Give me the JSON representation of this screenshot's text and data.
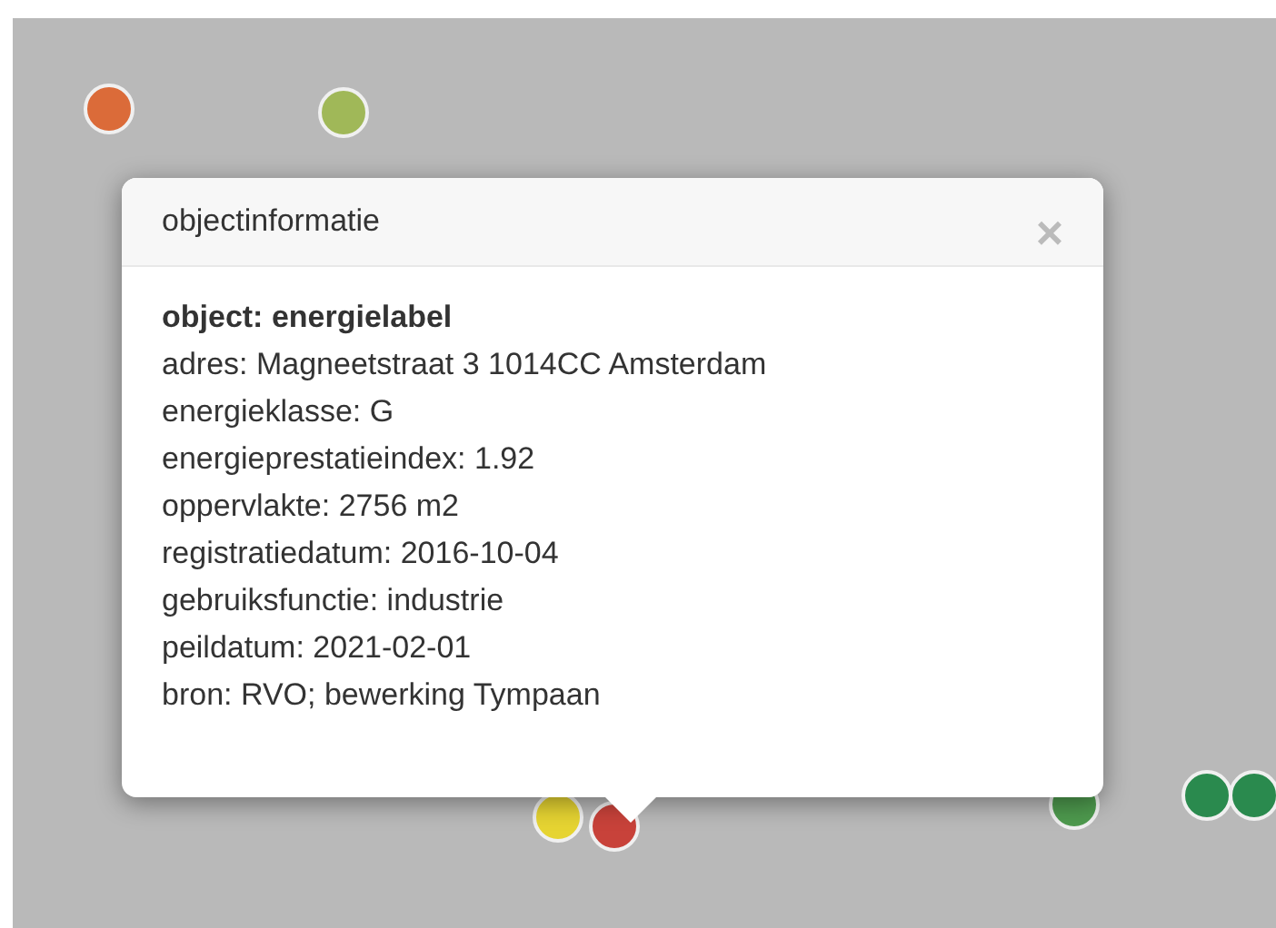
{
  "markers": [
    {
      "color": "#db6b39"
    },
    {
      "color": "#a0b858"
    },
    {
      "color": "#e6d432"
    },
    {
      "color": "#c8423a"
    },
    {
      "color": "#4e9a4e"
    },
    {
      "color": "#2a8a4e"
    },
    {
      "color": "#2a8a4e"
    }
  ],
  "popup": {
    "title": "objectinformatie",
    "close": "×",
    "lines": [
      {
        "kind": "heading",
        "text": "object: energielabel"
      },
      {
        "kind": "field",
        "text": "adres: Magneetstraat 3 1014CC Amsterdam"
      },
      {
        "kind": "field",
        "text": "energieklasse: G"
      },
      {
        "kind": "field",
        "text": "energieprestatieindex: 1.92"
      },
      {
        "kind": "field",
        "text": "oppervlakte: 2756 m2"
      },
      {
        "kind": "field",
        "text": "registratiedatum: 2016-10-04"
      },
      {
        "kind": "field",
        "text": "gebruiksfunctie: industrie"
      },
      {
        "kind": "field",
        "text": "peildatum: 2021-02-01"
      },
      {
        "kind": "field",
        "text": "bron: RVO; bewerking Tympaan"
      }
    ]
  }
}
